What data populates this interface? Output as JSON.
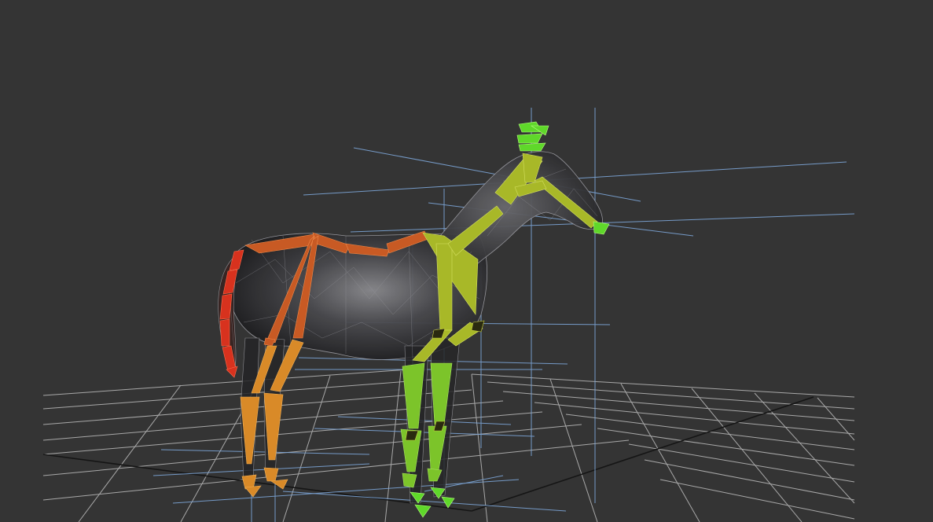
{
  "viewport": {
    "background": "#343434",
    "grid_color": "#bdbdbd",
    "grid_axis_color": "#1a1a1a",
    "gizmo_line_color": "#7da6d8",
    "mesh_fill": "#2c2c2e",
    "mesh_wire": "#9a9aa0"
  },
  "rig": {
    "chains": [
      {
        "name": "tail",
        "color": "#d8321e"
      },
      {
        "name": "spine-rear",
        "color": "#c85a24"
      },
      {
        "name": "hind-legs",
        "color": "#d98a28"
      },
      {
        "name": "neck-front",
        "color": "#a8b828"
      },
      {
        "name": "front-legs",
        "color": "#7cc42a"
      },
      {
        "name": "head",
        "color": "#5fd82a"
      }
    ]
  }
}
